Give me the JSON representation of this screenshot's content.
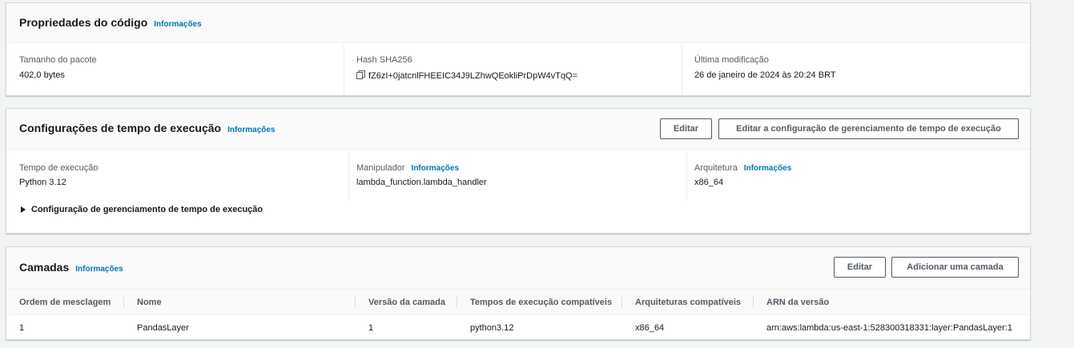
{
  "code_properties": {
    "title": "Propriedades do código",
    "info": "Informações",
    "package_size_label": "Tamanho do pacote",
    "package_size_value": "402,0 bytes",
    "hash_label": "Hash SHA256",
    "hash_value": "fZ6zI+0jatcnlFHEEIC34J9LZhwQEokliPrDpW4vTqQ=",
    "last_modified_label": "Última modificação",
    "last_modified_value": "26 de janeiro de 2024 às 20:24 BRT"
  },
  "runtime_settings": {
    "title": "Configurações de tempo de execução",
    "info": "Informações",
    "edit_button": "Editar",
    "edit_runtime_mgmt_button": "Editar a configuração de gerenciamento de tempo de execução",
    "runtime_label": "Tempo de execução",
    "runtime_value": "Python 3.12",
    "handler_label": "Manipulador",
    "handler_info": "Informações",
    "handler_value": "lambda_function.lambda_handler",
    "architecture_label": "Arquitetura",
    "architecture_info": "Informações",
    "architecture_value": "x86_64",
    "runtime_mgmt_expander": "Configuração de gerenciamento de tempo de execução"
  },
  "layers": {
    "title": "Camadas",
    "info": "Informações",
    "edit_button": "Editar",
    "add_layer_button": "Adicionar uma camada",
    "columns": [
      "Ordem de mesclagem",
      "Nome",
      "Versão da camada",
      "Tempos de execução compatíveis",
      "Arquiteturas compatíveis",
      "ARN da versão"
    ],
    "rows": [
      {
        "order": "1",
        "name": "PandasLayer",
        "version": "1",
        "runtimes": "python3.12",
        "architectures": "x86_64",
        "arn": "arn:aws:lambda:us-east-1:528300318331:layer:PandasLayer:1"
      }
    ]
  },
  "colors": {
    "link": "#0073bb",
    "text": "#16191f",
    "label": "#545b64",
    "background": "#f2f3f3"
  }
}
